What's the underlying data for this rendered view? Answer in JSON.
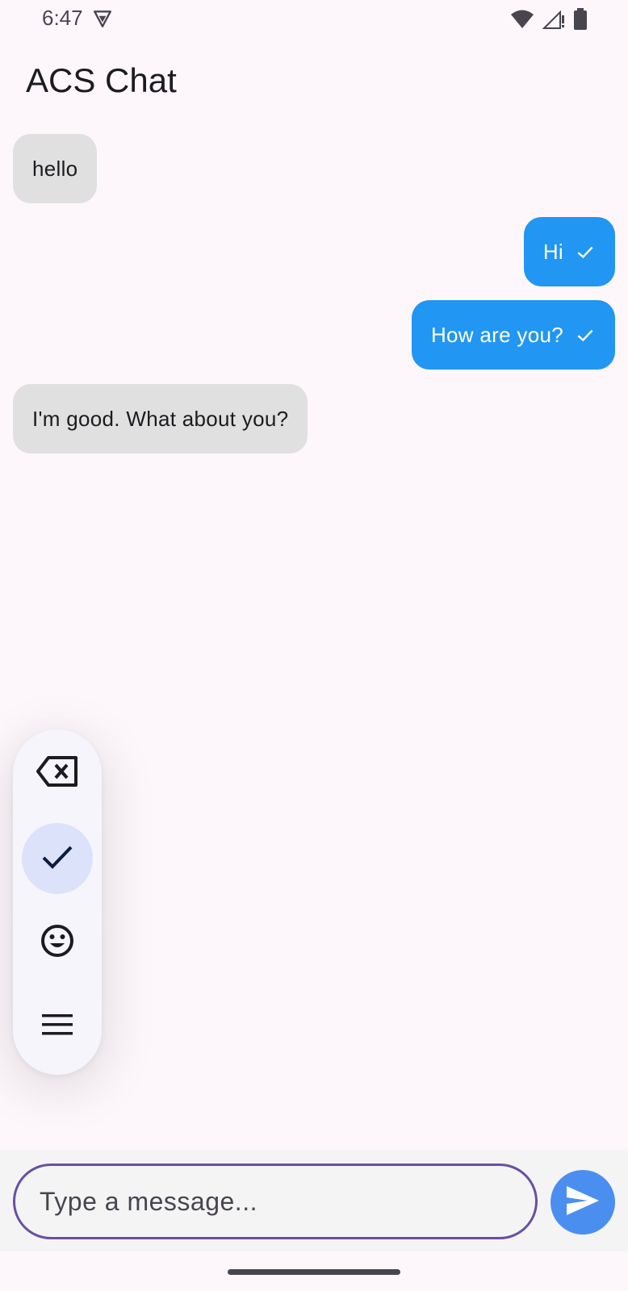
{
  "status_bar": {
    "time": "6:47",
    "icons": [
      "vpn-shield-icon",
      "wifi-icon",
      "cellular-signal-icon",
      "battery-icon"
    ]
  },
  "app_bar": {
    "title": "ACS Chat"
  },
  "messages": [
    {
      "text": "hello",
      "direction": "received"
    },
    {
      "text": "Hi",
      "direction": "sent",
      "status_icon": "check-icon"
    },
    {
      "text": "How are you?",
      "direction": "sent",
      "status_icon": "check-icon"
    },
    {
      "text": "I'm good. What about you?",
      "direction": "received"
    }
  ],
  "floating_toolbar": {
    "items": [
      {
        "icon": "backspace-icon",
        "selected": false
      },
      {
        "icon": "check-icon",
        "selected": true
      },
      {
        "icon": "emoji-icon",
        "selected": false
      },
      {
        "icon": "menu-icon",
        "selected": false
      }
    ]
  },
  "composer": {
    "placeholder": "Type a message...",
    "value": "",
    "send_icon": "send-icon"
  },
  "colors": {
    "background": "#fdf7fc",
    "sent_bubble": "#2196f3",
    "received_bubble": "#e0e0e0",
    "input_border": "#6750a4",
    "send_button": "#4a8ff0",
    "toolbar_selected": "#dbe2f9"
  }
}
